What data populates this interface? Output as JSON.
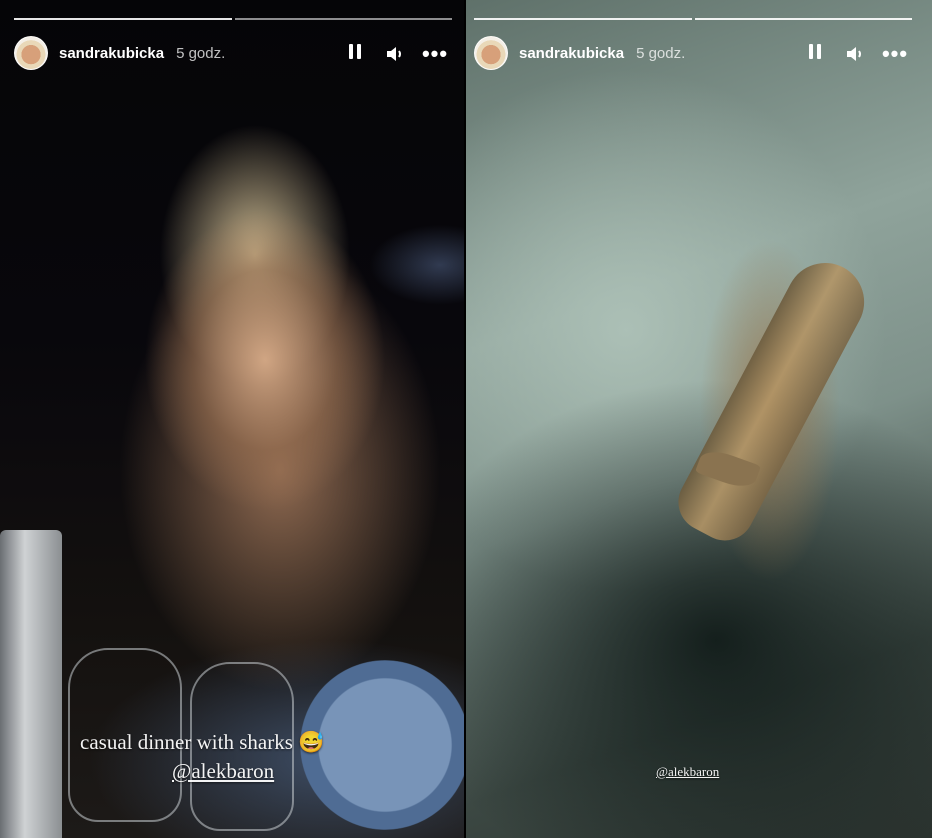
{
  "stories": [
    {
      "id": "left",
      "username": "sandrakubicka",
      "time": "5 godz.",
      "progress_segments": 2,
      "caption": {
        "text": "casual dinner with sharks 😅",
        "mention": "@alekbaron"
      }
    },
    {
      "id": "right",
      "username": "sandrakubicka",
      "time": "5 godz.",
      "progress_segments": 2,
      "caption": {
        "mention": "@alekbaron"
      }
    }
  ],
  "icons": {
    "pause": "pause-icon",
    "sound": "speaker-icon",
    "more": "more-options-icon"
  },
  "colors": {
    "text": "#ffffff",
    "progress_track": "rgba(255,255,255,0.55)"
  }
}
